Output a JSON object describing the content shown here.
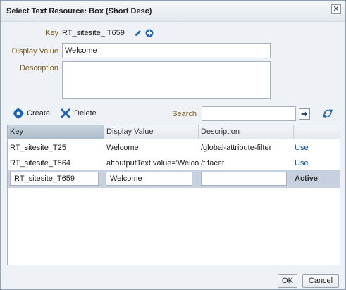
{
  "dialog": {
    "title": "Select Text Resource: Box (Short Desc)",
    "close_glyph": "✕"
  },
  "form": {
    "key_label": "Key",
    "key_value": "RT_sitesite_  T659",
    "display_value_label": "Display Value",
    "display_value": "Welcome",
    "description_label": "Description",
    "description_value": ""
  },
  "toolbar": {
    "create_label": "Create",
    "delete_label": "Delete",
    "search_label": "Search",
    "search_value": ""
  },
  "table": {
    "columns": [
      "Key",
      "Display Value",
      "Description",
      ""
    ],
    "rows": [
      {
        "key": "RT_sitesite_T25",
        "display": "Welcome",
        "description": "/global-attribute-filter",
        "action": "Use"
      },
      {
        "key": "RT_sitesite_T564",
        "display": "af:outputText value='Welcor",
        "description": "/f:facet",
        "action": "Use"
      }
    ],
    "active_row": {
      "key": "RT_sitesite_T659",
      "display": "Welcome",
      "description": "",
      "action": "Active"
    }
  },
  "footer": {
    "ok_label": "OK",
    "cancel_label": "Cancel"
  },
  "colors": {
    "label": "#7a5a14",
    "link": "#0b4ea2",
    "icon_blue": "#1f63b8",
    "active_row": "#c7d0df"
  },
  "icons": [
    "close-icon",
    "pencil-icon",
    "plus-circle-icon",
    "create-gear-icon",
    "delete-x-icon",
    "arrow-right-icon",
    "refresh-icon"
  ]
}
